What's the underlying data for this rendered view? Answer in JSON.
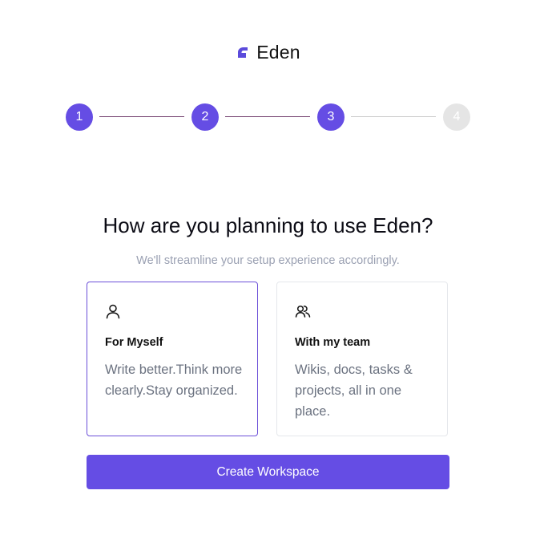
{
  "brand": {
    "name": "Eden",
    "logo_icon": "eden-logo-mark",
    "accent_color": "#654de4"
  },
  "stepper": {
    "current_step": 3,
    "steps": [
      {
        "label": "1",
        "state": "complete"
      },
      {
        "label": "2",
        "state": "complete"
      },
      {
        "label": "3",
        "state": "current"
      },
      {
        "label": "4",
        "state": "upcoming"
      }
    ]
  },
  "main": {
    "title": "How are you planning to use Eden?",
    "subtitle": "We'll streamline your setup experience accordingly."
  },
  "options": [
    {
      "icon": "user-icon",
      "title": "For Myself",
      "description": "Write better.Think more clearly.Stay organized.",
      "selected": true
    },
    {
      "icon": "users-icon",
      "title": "With my team",
      "description": "Wikis, docs, tasks & projects, all in one place.",
      "selected": false
    }
  ],
  "actions": {
    "create_label": "Create Workspace"
  }
}
